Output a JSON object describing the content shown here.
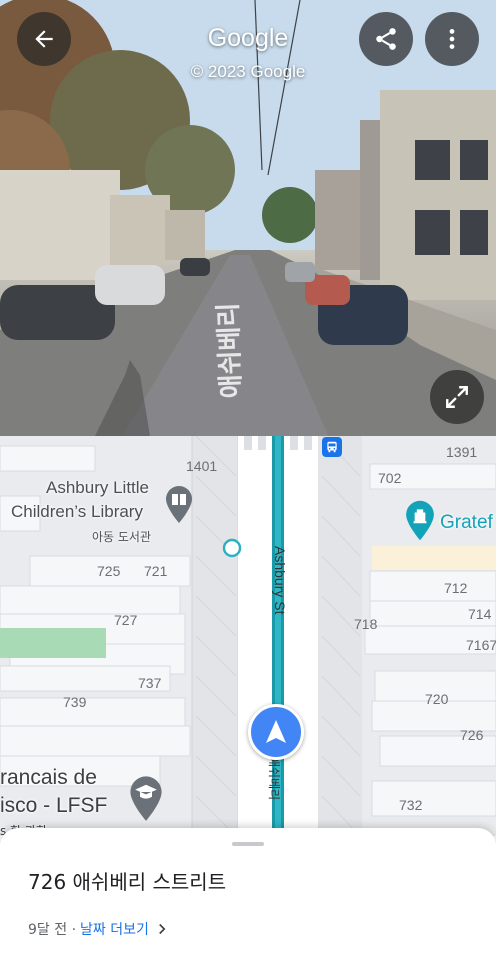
{
  "header": {
    "title": "Google",
    "copyright": "© 2023 Google"
  },
  "icons": {
    "back": "arrow-back-icon",
    "share": "share-icon",
    "more": "more-vert-icon",
    "expand": "expand-icon",
    "location": "navigation-arrow-icon",
    "bus": "bus-stop-icon",
    "book": "book-icon",
    "museum": "museum-icon",
    "school": "school-icon"
  },
  "colors": {
    "accent": "#1a73e8",
    "route": "#1a9aa8",
    "location_arrow": "#4285f4",
    "poi_teal": "#12a3b8",
    "poi_gray": "#6a7178"
  },
  "streetview": {
    "road_marking": "애쉬베리"
  },
  "map": {
    "street_name": "Ashbury St",
    "street_name_ko": "애쉬베리",
    "house_numbers": {
      "n1401": "1401",
      "n1391": "1391",
      "n702": "702",
      "n725": "725",
      "n721": "721",
      "n727": "727",
      "n718": "718",
      "n712": "712",
      "n714": "714",
      "n7167": "7167",
      "n737": "737",
      "n739": "739",
      "n720": "720",
      "n726": "726",
      "n732": "732"
    },
    "poi_library": {
      "name_line1": "Ashbury Little",
      "name_line2": "Children’s Library",
      "name_ko": "아동 도서관"
    },
    "poi_school": {
      "name_line1": "rancais de",
      "name_line2": "isco - LFSF",
      "name_ko": "s 학 과화"
    },
    "poi_right": {
      "name": "Gratef"
    }
  },
  "sheet": {
    "address": "726 애쉬베리 스트리트",
    "age": "9달 전 ·",
    "more_dates": "날짜 더보기"
  }
}
